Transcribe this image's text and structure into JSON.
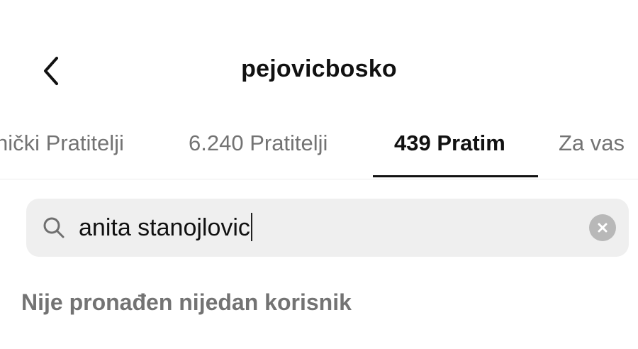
{
  "header": {
    "title": "pejovicbosko",
    "back_icon": "chevron-left-icon"
  },
  "tabs": [
    {
      "label": "nički Pratitelji",
      "active": false
    },
    {
      "label": "6.240 Pratitelji",
      "active": false
    },
    {
      "label": "439 Pratim",
      "active": true
    },
    {
      "label": "Za vas",
      "active": false
    }
  ],
  "search": {
    "value": "anita stanojlovic",
    "search_icon": "search-icon",
    "clear_icon": "clear-icon"
  },
  "results": {
    "empty_message": "Nije pronađen nijedan korisnik"
  },
  "colors": {
    "text_primary": "#111111",
    "text_secondary": "#737373",
    "search_bg": "#efefef",
    "clear_bg": "#b8b8b8"
  }
}
